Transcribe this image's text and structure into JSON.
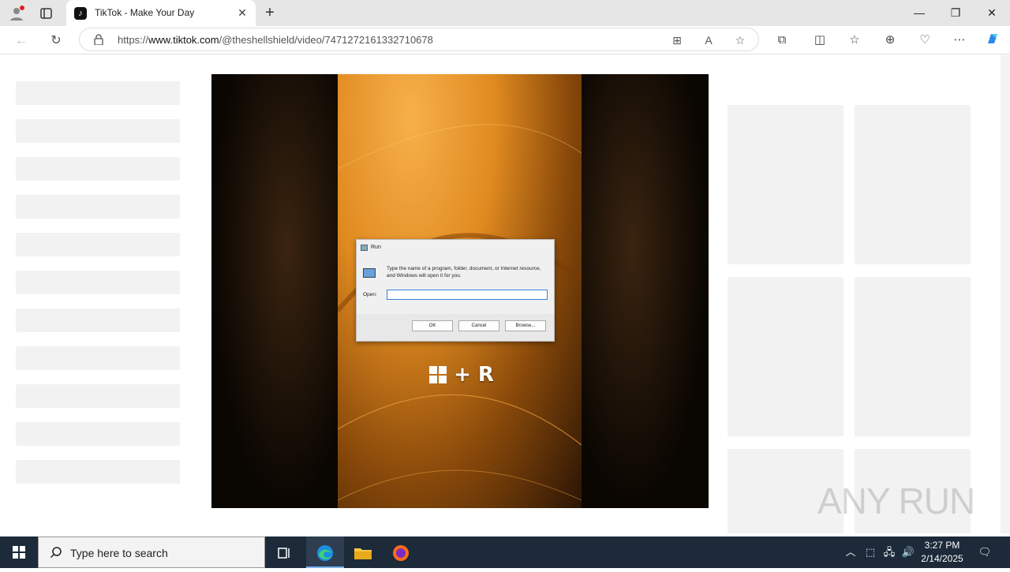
{
  "browser": {
    "tab": {
      "title": "TikTok - Make Your Day",
      "favicon": "tiktok-icon"
    },
    "url": {
      "prefix": "https://",
      "host": "www.tiktok.com",
      "path": "/@theshellshield/video/7471272161332710678"
    }
  },
  "video": {
    "run_dialog": {
      "title": "Run",
      "description": "Type the name of a program, folder, document, or Internet resource, and Windows will open it for you.",
      "open_label": "Open:",
      "ok_label": "OK",
      "cancel_label": "Cancel",
      "browse_label": "Browse..."
    },
    "shortcut_text": "+ R"
  },
  "watermark": "ANY RUN",
  "taskbar": {
    "search_placeholder": "Type here to search",
    "time": "3:27 PM",
    "date": "2/14/2025"
  },
  "colors": {
    "accent": "#3b7dd8",
    "taskbar": "#1c2a3a",
    "skeleton": "#f2f2f2"
  }
}
